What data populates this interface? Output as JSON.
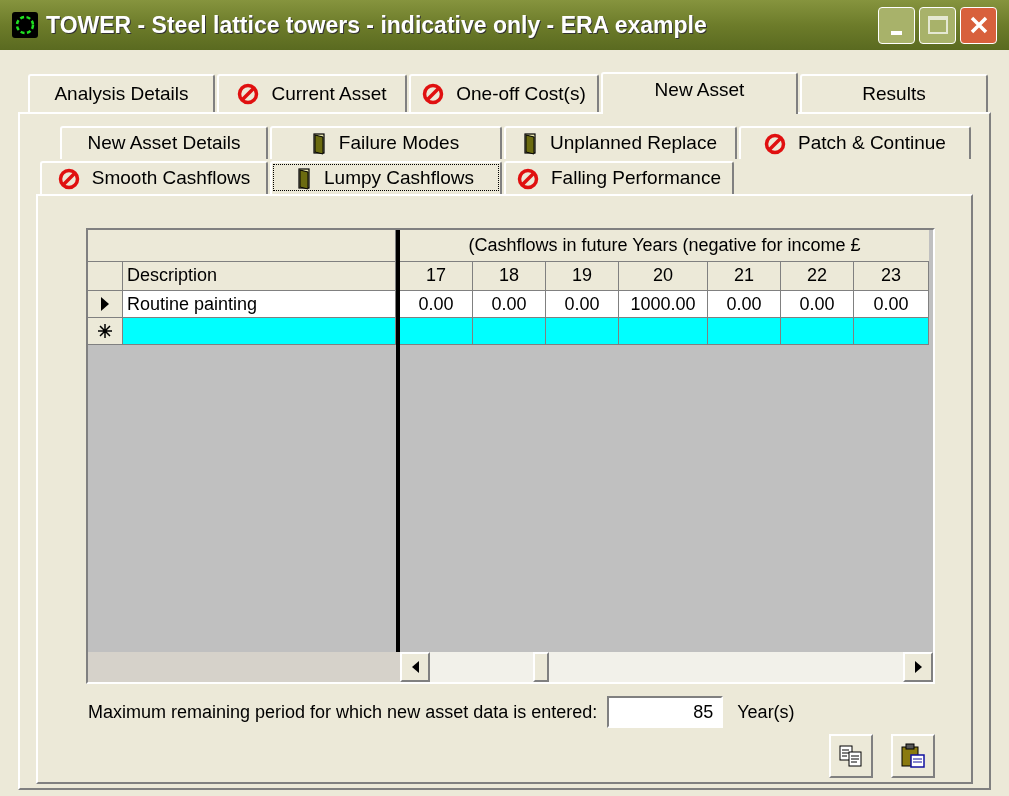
{
  "window": {
    "title": "TOWER - Steel lattice towers - indicative only - ERA example"
  },
  "tabs": [
    {
      "label": "Analysis Details",
      "kind": "plain",
      "selected": false
    },
    {
      "label": "Current Asset",
      "kind": "blocked",
      "selected": false
    },
    {
      "label": "One-off Cost(s)",
      "kind": "blocked",
      "selected": false
    },
    {
      "label": "New Asset",
      "kind": "plain",
      "selected": true
    },
    {
      "label": "Results",
      "kind": "plain",
      "selected": false
    }
  ],
  "sub_tab_rows": [
    [
      {
        "label": "New Asset Details",
        "kind": "plain",
        "selected": false
      },
      {
        "label": "Failure Modes",
        "kind": "door",
        "selected": false
      },
      {
        "label": "Unplanned Replace",
        "kind": "door",
        "selected": false
      },
      {
        "label": "Patch & Continue",
        "kind": "blocked",
        "selected": false
      }
    ],
    [
      {
        "label": "Smooth Cashflows",
        "kind": "blocked",
        "selected": false
      },
      {
        "label": "Lumpy Cashflows",
        "kind": "door",
        "selected": true
      },
      {
        "label": "Falling Performance",
        "kind": "blocked",
        "selected": false
      }
    ]
  ],
  "grid": {
    "group_header": "(Cashflows in future Years (negative for income £",
    "description_header": "Description",
    "years": [
      "17",
      "18",
      "19",
      "20",
      "21",
      "22",
      "23"
    ],
    "rows": [
      {
        "kind": "current",
        "description": "Routine painting",
        "values": [
          "0.00",
          "0.00",
          "0.00",
          "1000.00",
          "0.00",
          "0.00",
          "0.00"
        ]
      },
      {
        "kind": "new"
      }
    ]
  },
  "footer": {
    "label": "Maximum remaining period for which new asset data is entered:",
    "value": "85",
    "unit": "Year(s)"
  }
}
